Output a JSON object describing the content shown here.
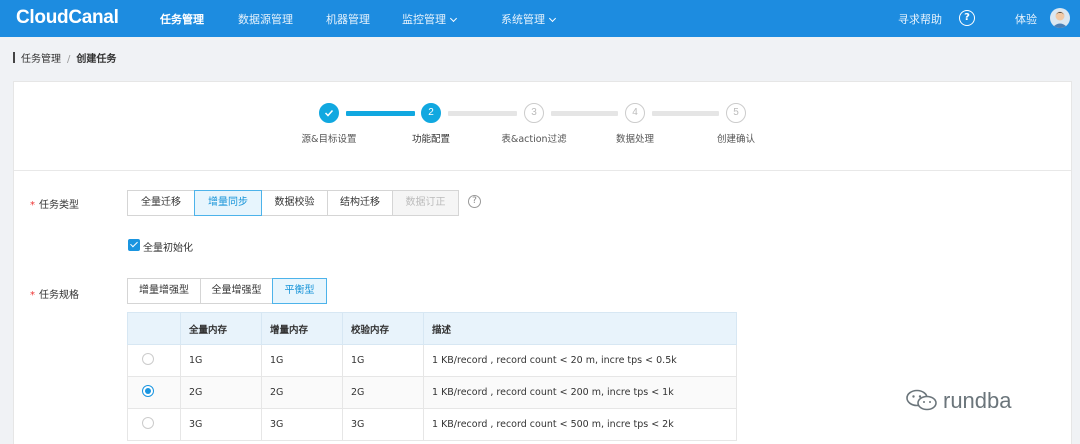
{
  "app": {
    "logo": "CloudCanal"
  },
  "nav": {
    "items": [
      {
        "label": "任务管理",
        "active": true
      },
      {
        "label": "数据源管理"
      },
      {
        "label": "机器管理"
      },
      {
        "label": "监控管理",
        "dropdown": true
      },
      {
        "label": "系统管理",
        "dropdown": true
      }
    ],
    "help_label": "寻求帮助",
    "help_icon": "?",
    "user_name": "体验"
  },
  "breadcrumb": {
    "parent": "任务管理",
    "separator": "/",
    "current": "创建任务"
  },
  "steps": [
    {
      "number": "1",
      "label": "源&目标设置",
      "status": "done"
    },
    {
      "number": "2",
      "label": "功能配置",
      "status": "active"
    },
    {
      "number": "3",
      "label": "表&action过滤",
      "status": "todo"
    },
    {
      "number": "4",
      "label": "数据处理",
      "status": "todo"
    },
    {
      "number": "5",
      "label": "创建确认",
      "status": "todo"
    }
  ],
  "task_type": {
    "required_mark": "*",
    "label": "任务类型",
    "options": [
      "全量迁移",
      "增量同步",
      "数据校验",
      "结构迁移",
      "数据订正"
    ],
    "selected": "增量同步",
    "disabled": [
      "数据订正"
    ],
    "help_icon": "?",
    "checkbox_label": "全量初始化",
    "checkbox_checked": true
  },
  "task_spec": {
    "required_mark": "*",
    "label": "任务规格",
    "options": [
      "增量增强型",
      "全量增强型",
      "平衡型"
    ],
    "selected": "平衡型",
    "table": {
      "headers": [
        "",
        "全量内存",
        "增量内存",
        "校验内存",
        "描述"
      ],
      "rows": [
        {
          "selected": false,
          "full": "1G",
          "incr": "1G",
          "check": "1G",
          "desc": "1 KB/record , record count < 20 m, incre tps < 0.5k"
        },
        {
          "selected": true,
          "full": "2G",
          "incr": "2G",
          "check": "2G",
          "desc": "1 KB/record , record count < 200 m, incre tps < 1k"
        },
        {
          "selected": false,
          "full": "3G",
          "incr": "3G",
          "check": "3G",
          "desc": "1 KB/record , record count < 500 m, incre tps < 2k"
        }
      ]
    }
  },
  "watermark": {
    "text": "rundba"
  },
  "colors": {
    "nav_bg": "#1d8ce0",
    "accent": "#11a8e0",
    "selected_bg": "#e7f5fd",
    "required": "#e33333"
  }
}
